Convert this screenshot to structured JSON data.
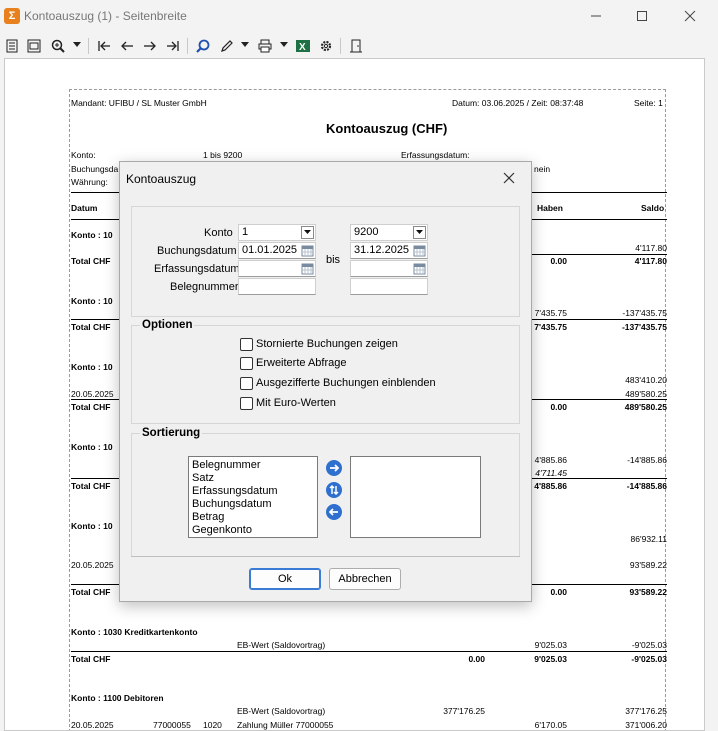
{
  "window": {
    "title": "Kontoauszug (1) - Seitenbreite",
    "app_icon_glyph": "Σ"
  },
  "report": {
    "mandant": "Mandant: UFIBU / SL Muster GmbH",
    "datum": "Datum: 03.06.2025 / Zeit: 08:37:48",
    "seite": "Seite: 1",
    "title": "Kontoauszug (CHF)",
    "konto_label": "Konto:",
    "konto_value": "1 bis 9200",
    "buchungs_label": "Buchungsda",
    "waehrung_label": "Währung:",
    "erfassungs_label": "Erfassungsdatum:",
    "nein": "nein",
    "col_datum": "Datum",
    "col_haben": "Haben",
    "col_saldo": "Saldo",
    "rows": {
      "k1": "Konto :  10",
      "k1_saldo": "4'117.80",
      "t1": "Total  CHF",
      "t1_haben": "0.00",
      "t1_saldo": "4'117.80",
      "k2": "Konto :  10",
      "k2_haben": "7'435.75",
      "k2_saldo": "-137'435.75",
      "t2": "Total  CHF",
      "t2_haben": "7'435.75",
      "t2_saldo": "-137'435.75",
      "k3": "Konto :  10",
      "k3_saldo1": "483'410.20",
      "k3_date": "20.05.2025",
      "k3_saldo2": "489'580.25",
      "t3": "Total  CHF",
      "t3_haben": "0.00",
      "t3_saldo": "489'580.25",
      "k4": "Konto :  10",
      "k4_haben1": "4'885.86",
      "k4_haben2": "4'711.45",
      "k4_saldo": "-14'885.86",
      "t4": "Total  CHF",
      "t4_haben": "4'885.86",
      "t4_saldo": "-14'885.86",
      "k5": "Konto :  10",
      "k5_saldo1": "86'932.11",
      "k5_date": "20.05.2025",
      "k5_saldo2": "93'589.22",
      "t5": "Total  CHF",
      "t5_haben": "0.00",
      "t5_saldo": "93'589.22",
      "k6": "Konto :  1030 Kreditkartenkonto",
      "k6_text": "EB-Wert (Saldovortrag)",
      "k6_haben": "9'025.03",
      "k6_saldo": "-9'025.03",
      "t6": "Total  CHF",
      "t6_soll": "0.00",
      "t6_haben": "9'025.03",
      "t6_saldo": "-9'025.03",
      "k7": "Konto :  1100 Debitoren",
      "k7_text": "EB-Wert (Saldovortrag)",
      "k7_soll": "377'176.25",
      "k7_saldo": "377'176.25",
      "k7r_date": "20.05.2025",
      "k7r_nr": "77000055",
      "k7r_gk": "1020",
      "k7r_text": "Zahlung Müller 77000055",
      "k7r_haben": "6'170.05",
      "k7r_saldo": "371'006.20"
    }
  },
  "dialog": {
    "title": "Kontoauszug",
    "konto_label": "Konto",
    "konto_from": "1",
    "konto_to": "9200",
    "buchungsdatum_label": "Buchungsdatum",
    "buchungsdatum_from": "01.01.2025",
    "buchungsdatum_to": "31.12.2025",
    "erfassungsdatum_label": "Erfassungsdatum",
    "erfassungsdatum_from": "",
    "erfassungsdatum_to": "",
    "belegnummer_label": "Belegnummer",
    "belegnummer_from": "",
    "belegnummer_to": "",
    "bis_label": "bis",
    "optionen_label": "Optionen",
    "options": [
      "Stornierte Buchungen zeigen",
      "Erweiterte Abfrage",
      "Ausgezifferte Buchungen einblenden",
      "Mit Euro-Werten"
    ],
    "sortierung_label": "Sortierung",
    "sort_available": [
      "Belegnummer",
      "Satz",
      "Erfassungsdatum",
      "Buchungsdatum",
      "Betrag",
      "Gegenkonto"
    ],
    "ok_label": "Ok",
    "cancel_label": "Abbrechen"
  },
  "colors": {
    "accent": "#2f6fd0",
    "app_icon": "#e8801e",
    "excel_green": "#1e7145"
  }
}
